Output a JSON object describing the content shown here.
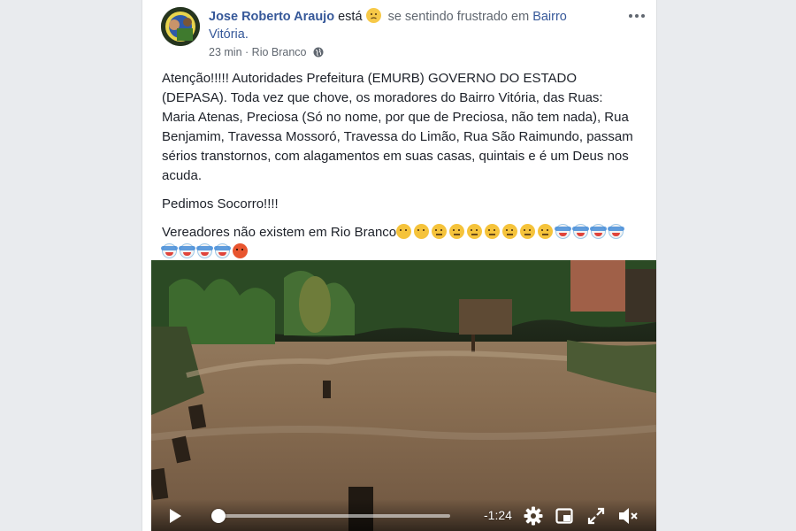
{
  "post": {
    "author": "Jose Roberto Araujo",
    "feeling_prefix": "está",
    "feeling_text": "se sentindo frustrado em",
    "place": "Bairro Vitória.",
    "time": "23 min",
    "separator": "·",
    "location": "Rio Branco",
    "paragraphs": [
      "Atenção!!!!! Autoridades Prefeitura (EMURB) GOVERNO DO ESTADO (DEPASA). Toda vez que chove, os moradores do Bairro Vitória, das Ruas: Maria Atenas, Preciosa (Só no nome, por que de Preciosa, não tem nada), Rua Benjamim, Travessa Mossoró, Travessa do Limão, Rua São Raimundo, passam sérios transtornos, com alagamentos em suas casas, quintais e é um Deus nos acuda.",
      "Pedimos Socorro!!!!",
      "Vereadores não existem em Rio Branco"
    ],
    "emoji_sequence": [
      "worried",
      "thinking",
      "triumph",
      "triumph",
      "triumph",
      "triumph",
      "triumph",
      "triumph",
      "triumph",
      "clown",
      "clown",
      "clown",
      "clown",
      "clown",
      "clown",
      "clown",
      "clown",
      "angry"
    ]
  },
  "video": {
    "time_remaining": "-1:24",
    "progress": 0.03,
    "colors": {
      "progress": "#4f86e8"
    }
  },
  "colors": {
    "link": "#365899",
    "text": "#1d2129",
    "muted": "#606770",
    "page_bg": "#e9ebee"
  },
  "icons": [
    "more-options-icon",
    "globe-icon",
    "feeling-emoji-icon",
    "play-icon",
    "settings-gear-icon",
    "picture-in-picture-icon",
    "fullscreen-icon",
    "volume-muted-icon"
  ]
}
